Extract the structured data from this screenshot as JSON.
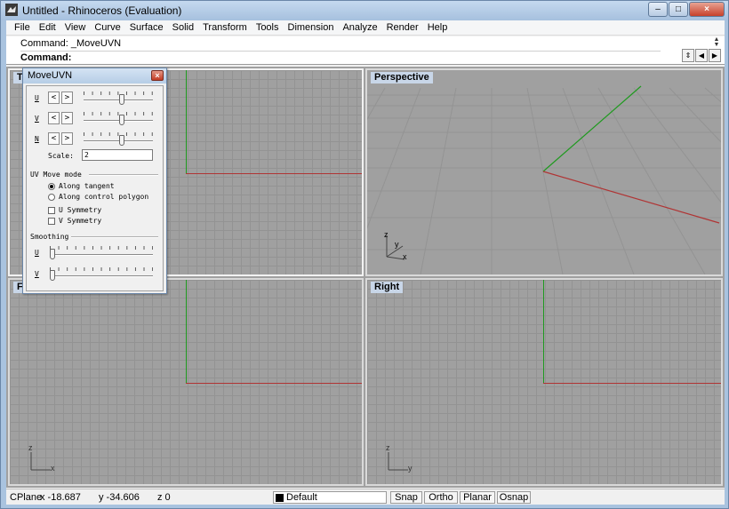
{
  "window": {
    "title": "Untitled - Rhinoceros (Evaluation)",
    "minimize_glyph": "–",
    "maximize_glyph": "□",
    "close_glyph": "×"
  },
  "menubar": {
    "items": [
      "File",
      "Edit",
      "View",
      "Curve",
      "Surface",
      "Solid",
      "Transform",
      "Tools",
      "Dimension",
      "Analyze",
      "Render",
      "Help"
    ]
  },
  "command": {
    "history": "Command: _MoveUVN",
    "prompt": "Command:"
  },
  "viewports": {
    "top": {
      "label": "To"
    },
    "perspective": {
      "label": "Perspective",
      "gizmo_x": "x",
      "gizmo_y": "y",
      "gizmo_z": "z"
    },
    "front": {
      "label": "Fr",
      "gizmo_x": "x",
      "gizmo_z": "z"
    },
    "right": {
      "label": "Right",
      "gizmo_y": "y",
      "gizmo_z": "z"
    }
  },
  "dialog": {
    "title": "MoveUVN",
    "rows": [
      {
        "label": "U",
        "left": "<",
        "right": ">",
        "value": 0.55
      },
      {
        "label": "V",
        "left": "<",
        "right": ">",
        "value": 0.55
      },
      {
        "label": "N",
        "left": "<",
        "right": ">",
        "value": 0.55
      }
    ],
    "scale_label": "Scale:",
    "scale_value": "2",
    "move_mode_label": "UV Move mode",
    "along_tangent": "Along tangent",
    "along_polygon": "Along control polygon",
    "u_symmetry": "U Symmetry",
    "v_symmetry": "V Symmetry",
    "smoothing_label": "Smoothing",
    "smoothing_u_label": "U",
    "smoothing_v_label": "V",
    "smoothing_u_value": 0.0,
    "smoothing_v_value": 0.0
  },
  "statusbar": {
    "cplane": "CPlane",
    "x": "x -18.687",
    "y": "y -34.606",
    "z": "z 0",
    "layer": "Default",
    "snap": "Snap",
    "ortho": "Ortho",
    "planar": "Planar",
    "osnap": "Osnap"
  },
  "colors": {
    "x_axis": "#b03434",
    "y_axis": "#1f9a1f",
    "viewport_bg": "#a0a0a0"
  }
}
